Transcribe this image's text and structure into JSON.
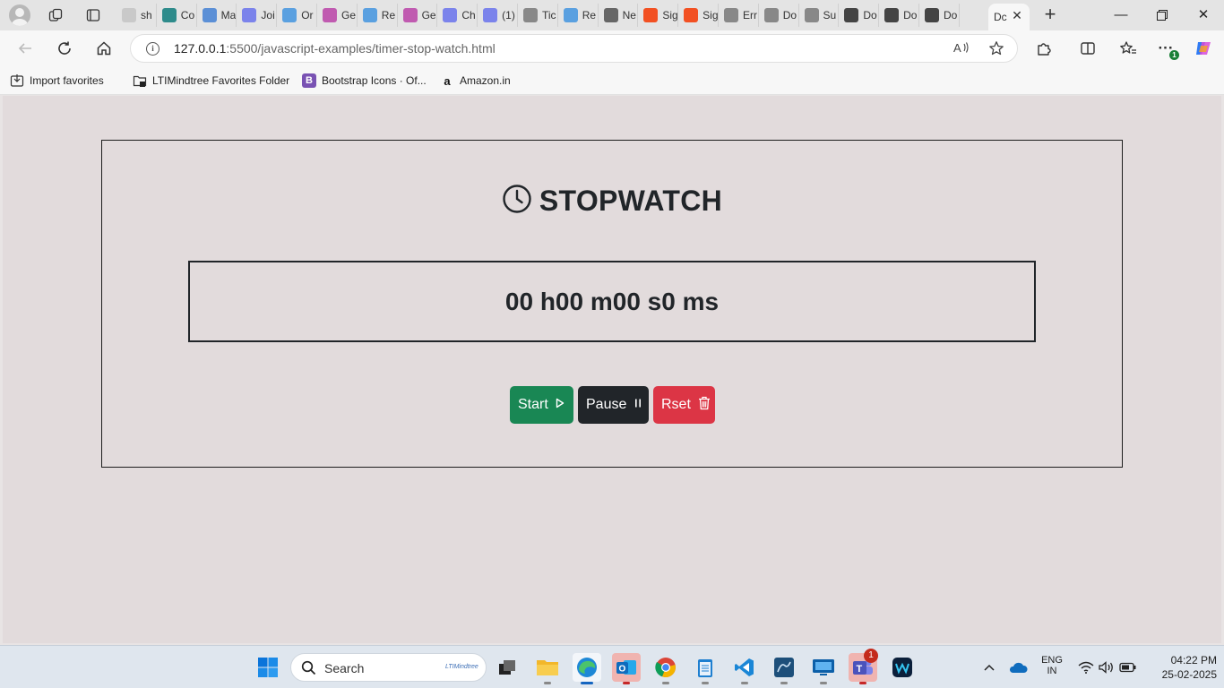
{
  "browser": {
    "tabs": [
      {
        "title": "sh",
        "color": "#c9c9c9"
      },
      {
        "title": "Co",
        "color": "#2e8b8b"
      },
      {
        "title": "Ma",
        "color": "#5b8fd6"
      },
      {
        "title": "Joi",
        "color": "#7b83eb"
      },
      {
        "title": "Or",
        "color": "#5aa0e0"
      },
      {
        "title": "Ge",
        "color": "#c05ab0"
      },
      {
        "title": "Re",
        "color": "#5aa0e0"
      },
      {
        "title": "Ge",
        "color": "#c05ab0"
      },
      {
        "title": "Ch",
        "color": "#7b83eb"
      },
      {
        "title": "(1)",
        "color": "#7b83eb"
      },
      {
        "title": "Tic",
        "color": "#888888"
      },
      {
        "title": "Re",
        "color": "#5aa0e0"
      },
      {
        "title": "Ne",
        "color": "#666666"
      },
      {
        "title": "Sig",
        "color": "#f25022"
      },
      {
        "title": "Sig",
        "color": "#f25022"
      },
      {
        "title": "Err",
        "color": "#888888"
      },
      {
        "title": "Do",
        "color": "#888888"
      },
      {
        "title": "Su",
        "color": "#888888"
      },
      {
        "title": "Do",
        "color": "#444444"
      },
      {
        "title": "Do",
        "color": "#444444"
      },
      {
        "title": "Do",
        "color": "#444444"
      }
    ],
    "active_tab": {
      "title": "Dc"
    },
    "address": {
      "host": "127.0.0.1",
      "path": ":5500/javascript-examples/timer-stop-watch.html"
    },
    "extension_badge": "1",
    "favorites": [
      {
        "label": "Import favorites",
        "icon": "import-icon"
      },
      {
        "label": "LTIMindtree Favorites Folder",
        "icon": "folder-icon"
      },
      {
        "label": "Bootstrap Icons · Of...",
        "icon": "bootstrap-logo"
      },
      {
        "label": "Amazon.in",
        "icon": "amazon-logo"
      }
    ]
  },
  "stopwatch": {
    "title": "STOPWATCH",
    "time": "00 h00 m00 s0 ms",
    "buttons": {
      "start": "Start",
      "pause": "Pause",
      "reset": "Rset"
    },
    "colors": {
      "start": "#198754",
      "pause": "#212529",
      "reset": "#dc3545",
      "background": "#e2dbdc"
    }
  },
  "taskbar": {
    "search_placeholder": "Search",
    "search_brand": "LTIMindtree",
    "teams_badge": "1",
    "language": {
      "line1": "ENG",
      "line2": "IN"
    },
    "time": "04:22 PM",
    "date": "25-02-2025"
  }
}
